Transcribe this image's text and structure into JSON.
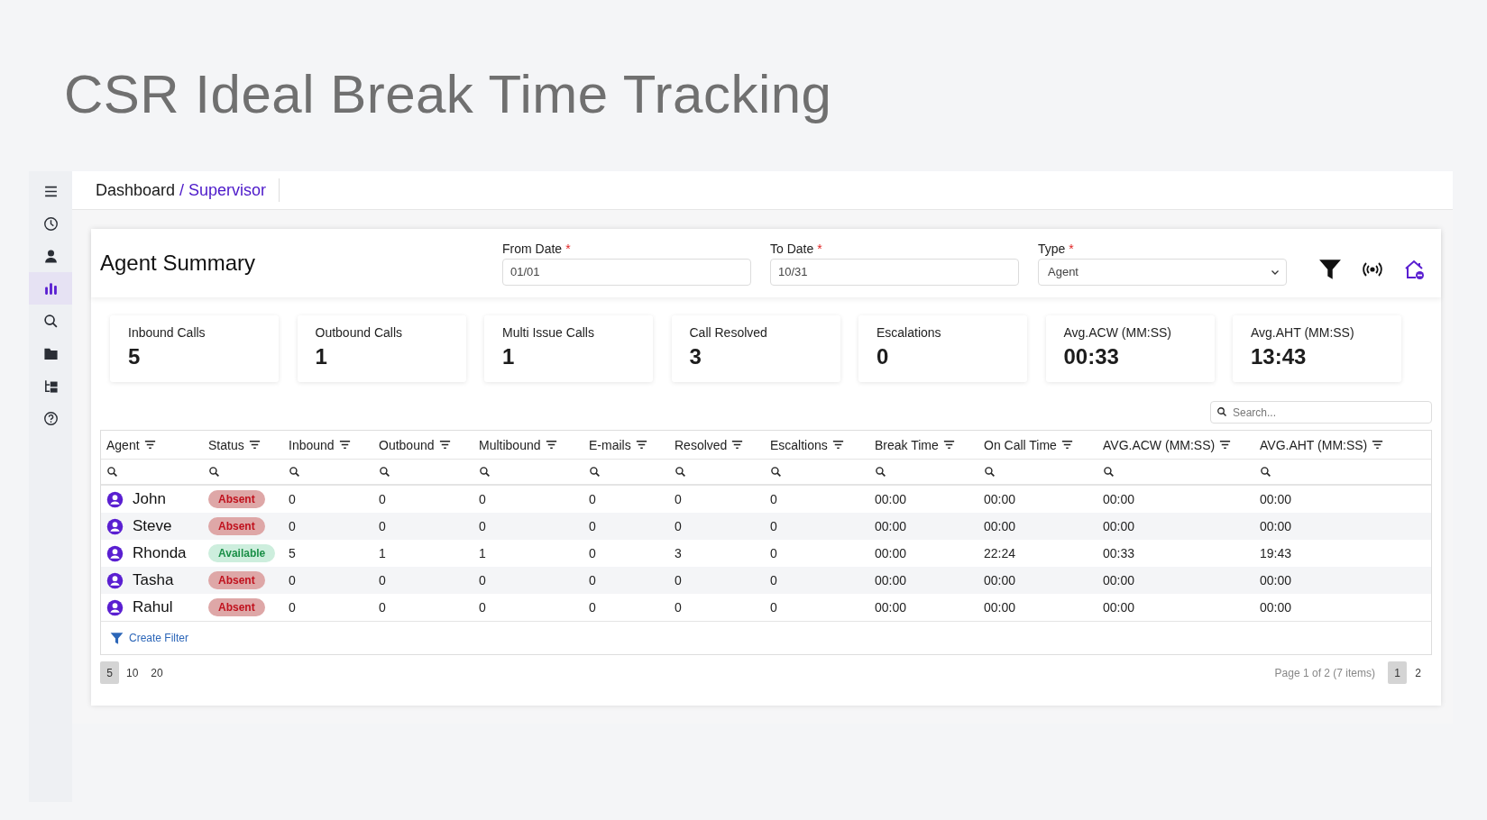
{
  "page_title": "CSR Ideal Break Time Tracking",
  "sidebar": {
    "items": [
      {
        "kind": "menu",
        "selected": false
      },
      {
        "kind": "clock",
        "selected": false
      },
      {
        "kind": "person",
        "selected": false
      },
      {
        "kind": "chart",
        "selected": true
      },
      {
        "kind": "search",
        "selected": false
      },
      {
        "kind": "folder",
        "selected": false
      },
      {
        "kind": "tree",
        "selected": false
      },
      {
        "kind": "help",
        "selected": false
      }
    ]
  },
  "breadcrumb": {
    "parent": "Dashboard",
    "separator": "/",
    "current": "Supervisor"
  },
  "panel": {
    "title": "Agent Summary",
    "fields": [
      {
        "kind": "input",
        "label": "From Date",
        "required_mark": "*",
        "value": "01/01"
      },
      {
        "kind": "input",
        "label": "To Date",
        "required_mark": "*",
        "value": "10/31"
      },
      {
        "kind": "select",
        "label": "Type",
        "required_mark": "*",
        "value": "Agent"
      }
    ],
    "stats": [
      {
        "label": "Inbound Calls",
        "value": "5"
      },
      {
        "label": "Outbound Calls",
        "value": "1"
      },
      {
        "label": "Multi Issue Calls",
        "value": "1"
      },
      {
        "label": "Call Resolved",
        "value": "3"
      },
      {
        "label": "Escalations",
        "value": "0"
      },
      {
        "label": "Avg.ACW (MM:SS)",
        "value": "00:33"
      },
      {
        "label": "Avg.AHT (MM:SS)",
        "value": "13:43"
      }
    ],
    "search": {
      "placeholder": "Search..."
    },
    "table": {
      "columns": [
        "Agent",
        "Status",
        "Inbound",
        "Outbound",
        "Multibound",
        "E-mails",
        "Resolved",
        "Escaltions",
        "Break Time",
        "On Call Time",
        "AVG.ACW (MM:SS)",
        "AVG.AHT (MM:SS)"
      ],
      "rows": [
        {
          "kind": "absent",
          "cells": [
            "John",
            "Absent",
            "0",
            "0",
            "0",
            "0",
            "0",
            "0",
            "00:00",
            "00:00",
            "00:00",
            "00:00"
          ]
        },
        {
          "kind": "absent",
          "cells": [
            "Steve",
            "Absent",
            "0",
            "0",
            "0",
            "0",
            "0",
            "0",
            "00:00",
            "00:00",
            "00:00",
            "00:00"
          ]
        },
        {
          "kind": "available",
          "cells": [
            "Rhonda",
            "Available",
            "5",
            "1",
            "1",
            "0",
            "3",
            "0",
            "00:00",
            "22:24",
            "00:33",
            "19:43"
          ]
        },
        {
          "kind": "absent",
          "cells": [
            "Tasha",
            "Absent",
            "0",
            "0",
            "0",
            "0",
            "0",
            "0",
            "00:00",
            "00:00",
            "00:00",
            "00:00"
          ]
        },
        {
          "kind": "absent",
          "cells": [
            "Rahul",
            "Absent",
            "0",
            "0",
            "0",
            "0",
            "0",
            "0",
            "00:00",
            "00:00",
            "00:00",
            "00:00"
          ]
        }
      ],
      "create_filter": "Create Filter"
    },
    "pager": {
      "sizes": [
        {
          "label": "5",
          "selected": true
        },
        {
          "label": "10",
          "selected": false
        },
        {
          "label": "20",
          "selected": false
        }
      ],
      "info": "Page 1 of 2 (7 items)",
      "pages": [
        {
          "label": "1",
          "selected": true
        },
        {
          "label": "2",
          "selected": false
        }
      ]
    }
  }
}
